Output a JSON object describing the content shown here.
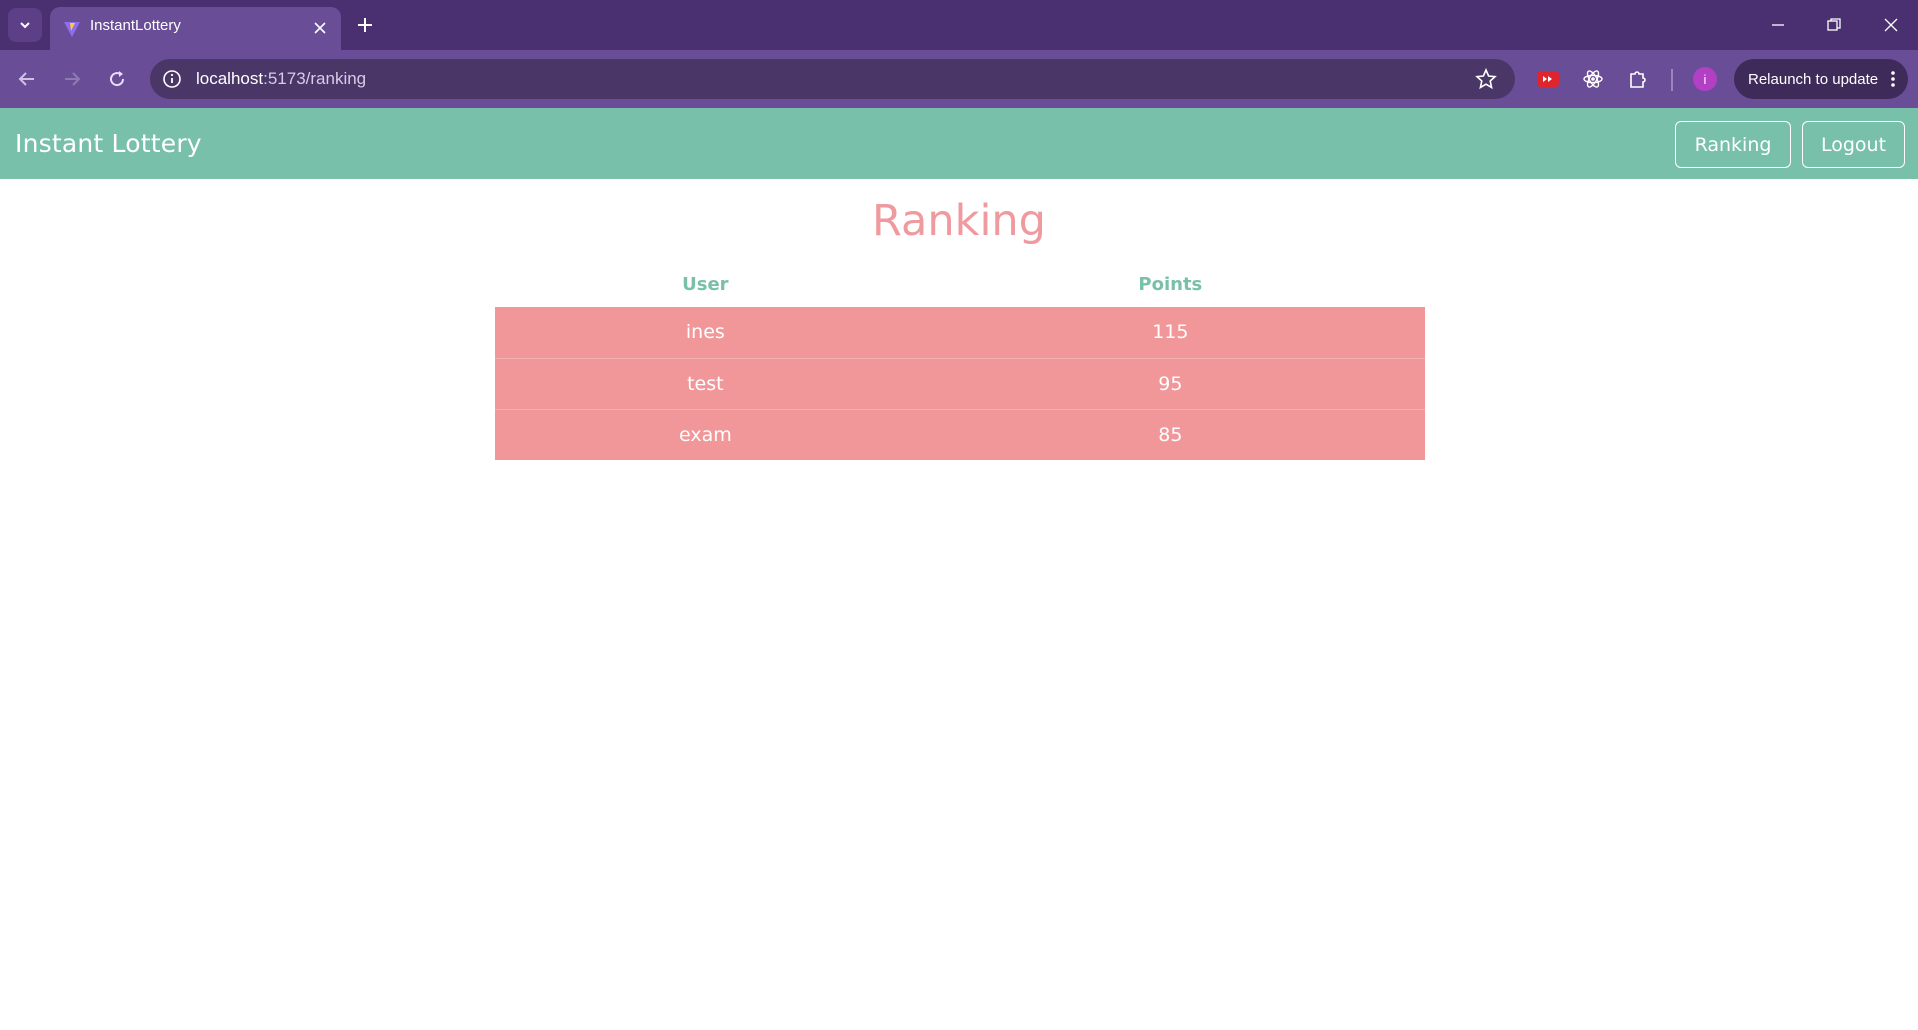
{
  "browser": {
    "tab_title": "InstantLottery",
    "url_host": "localhost",
    "url_path": ":5173/ranking",
    "relaunch_label": "Relaunch to update",
    "profile_initial": "i"
  },
  "navbar": {
    "brand": "Instant Lottery",
    "ranking_label": "Ranking",
    "logout_label": "Logout"
  },
  "page": {
    "title": "Ranking",
    "columns": [
      "User",
      "Points"
    ],
    "rows": [
      {
        "user": "ines",
        "points": "115"
      },
      {
        "user": "test",
        "points": "95"
      },
      {
        "user": "exam",
        "points": "85"
      }
    ]
  },
  "colors": {
    "browser_frame": "#4a3070",
    "navbar": "#79c0ab",
    "accent_pink": "#ef9a9f",
    "row_background": "#f19799"
  }
}
